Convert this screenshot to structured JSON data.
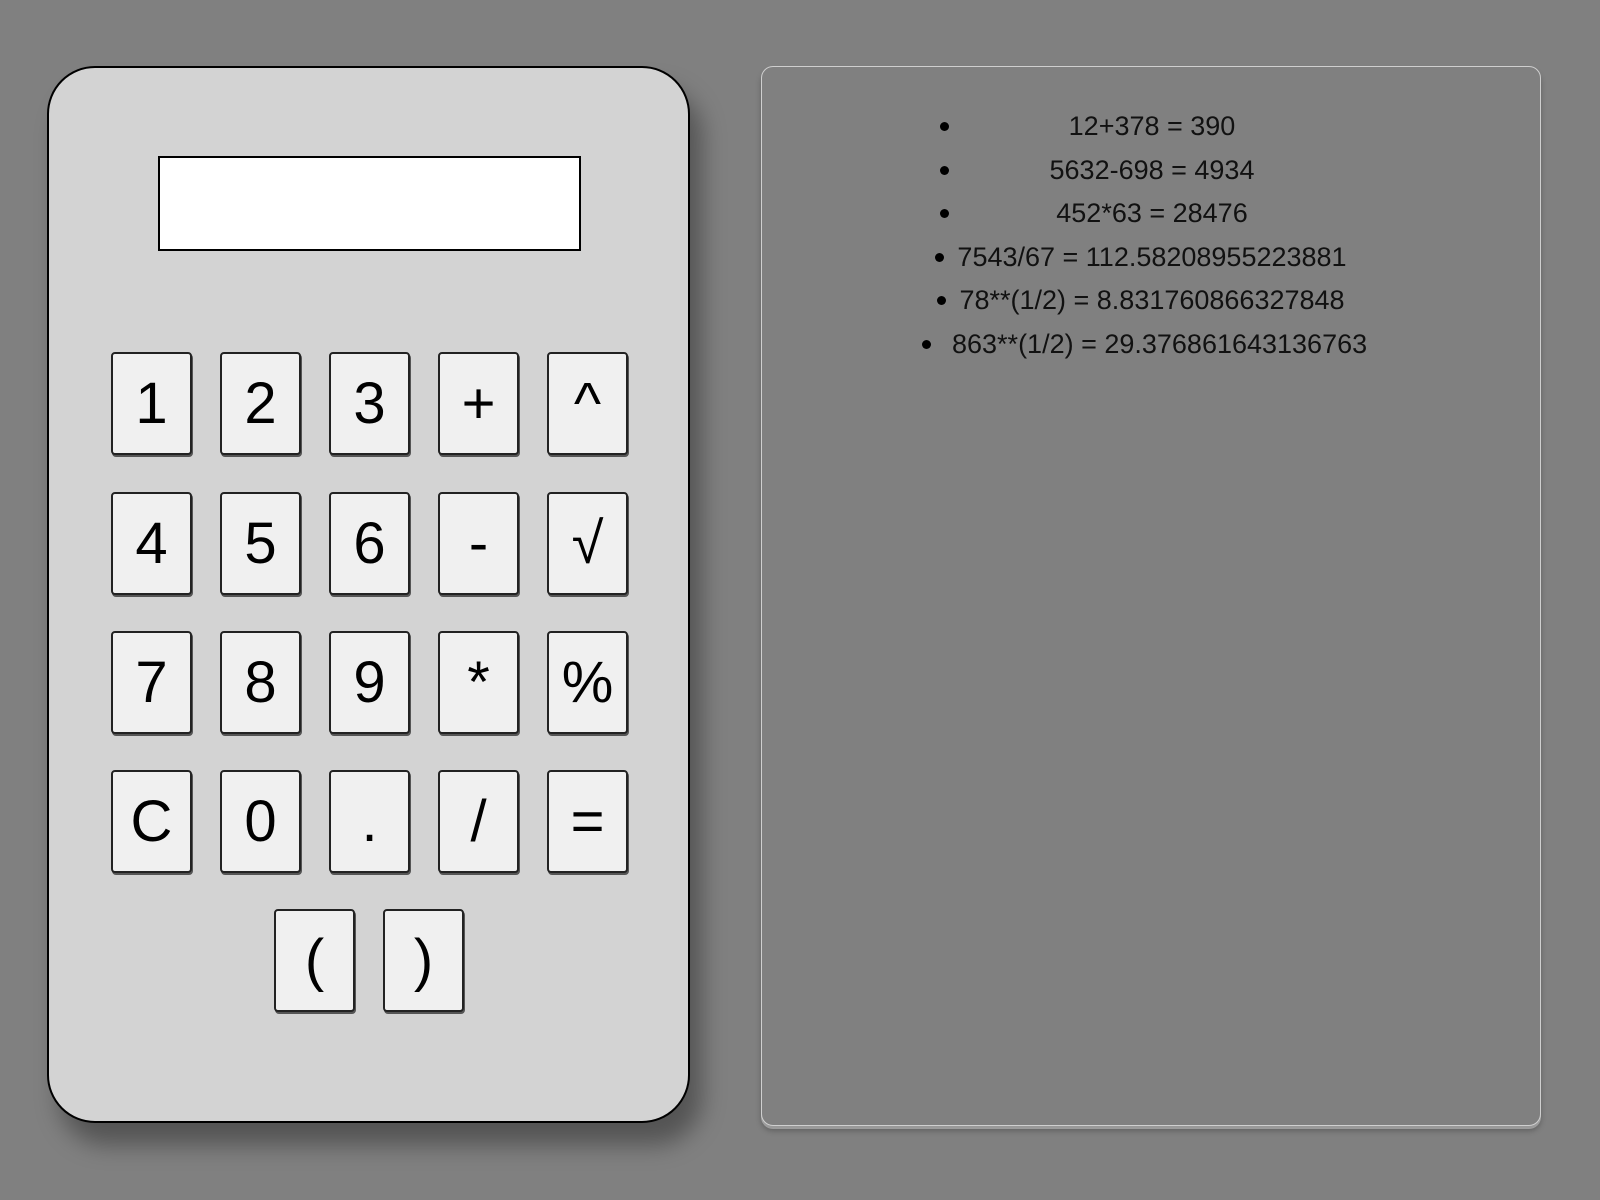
{
  "calculator": {
    "display_value": "",
    "keys": [
      "1",
      "2",
      "3",
      "+",
      "^",
      "4",
      "5",
      "6",
      "-",
      "√",
      "7",
      "8",
      "9",
      "*",
      "%",
      "C",
      "0",
      ".",
      "/",
      "=",
      "(",
      ")"
    ]
  },
  "history": {
    "entries": [
      "12+378 = 390",
      "5632-698 = 4934",
      "452*63 = 28476",
      "7543/67 = 112.58208955223881",
      "78**(1/2) = 8.831760866327848",
      "863**(1/2) = 29.376861643136763"
    ]
  }
}
